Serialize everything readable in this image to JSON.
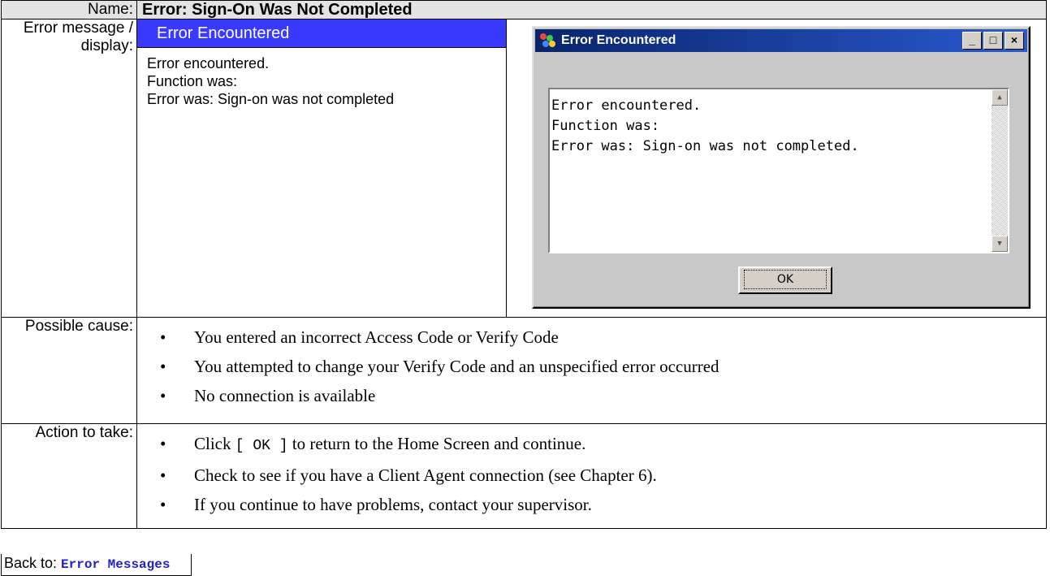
{
  "name_label": "Name:",
  "name_value": "Error: Sign-On Was Not Completed",
  "error_label": "Error message / display:",
  "simple": {
    "title": "Error Encountered",
    "lines": [
      "Error encountered.",
      "Function was:",
      "Error was: Sign-on was not completed"
    ]
  },
  "dialog": {
    "title": "Error Encountered",
    "lines": [
      "Error encountered.",
      "Function was:",
      "Error was: Sign-on was not completed."
    ],
    "ok_label": "OK",
    "minimize": "_",
    "maximize": "□",
    "close": "×"
  },
  "cause_label": "Possible cause:",
  "causes": [
    "You entered an incorrect Access Code or Verify Code",
    "You attempted to change your Verify Code and an unspecified error occurred",
    "No connection is available"
  ],
  "action_label": "Action to take:",
  "actions": {
    "a1_pre": "Click ",
    "a1_code": "[ OK ]",
    "a1_post": " to return to the Home Screen and continue.",
    "a2": "Check to see if you have a Client Agent connection (see Chapter 6).",
    "a3": "If you continue to have problems, contact your supervisor."
  },
  "back_label": "Back to: ",
  "back_link": "Error Messages"
}
